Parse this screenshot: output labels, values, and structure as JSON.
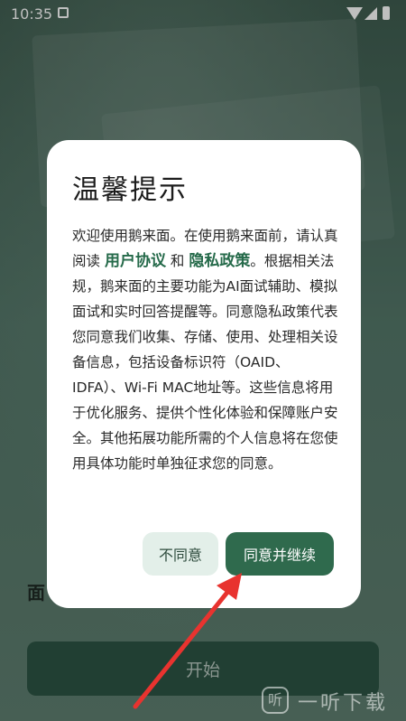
{
  "status_bar": {
    "time": "10:35",
    "icons": [
      "notification-icon",
      "wifi-icon",
      "signal-icon",
      "battery-icon"
    ]
  },
  "background": {
    "label_fragment": "面",
    "start_button": "开始"
  },
  "dialog": {
    "title": "温馨提示",
    "body_part1": "欢迎使用鹅来面。在使用鹅来面前，请认真阅读",
    "link_user_agreement": "用户协议",
    "and_text": "和",
    "link_privacy_policy": "隐私政策",
    "body_part2": "。根据相关法规，鹅来面的主要功能为AI面试辅助、模拟面试和实时回答提醒等。同意隐私政策代表您同意我们收集、存储、使用、处理相关设备信息，包括设备标识符（OAID、IDFA）、Wi-Fi MAC地址等。这些信息将用于优化服务、提供个性化体验和保障账户安全。其他拓展功能所需的个人信息将在您使用具体功能时单独征求您的同意。",
    "disagree_button": "不同意",
    "agree_button": "同意并继续"
  },
  "annotation": {
    "arrow_color": "#e8332f"
  },
  "watermark": {
    "logo_glyph": "听",
    "text": "一听下载"
  }
}
